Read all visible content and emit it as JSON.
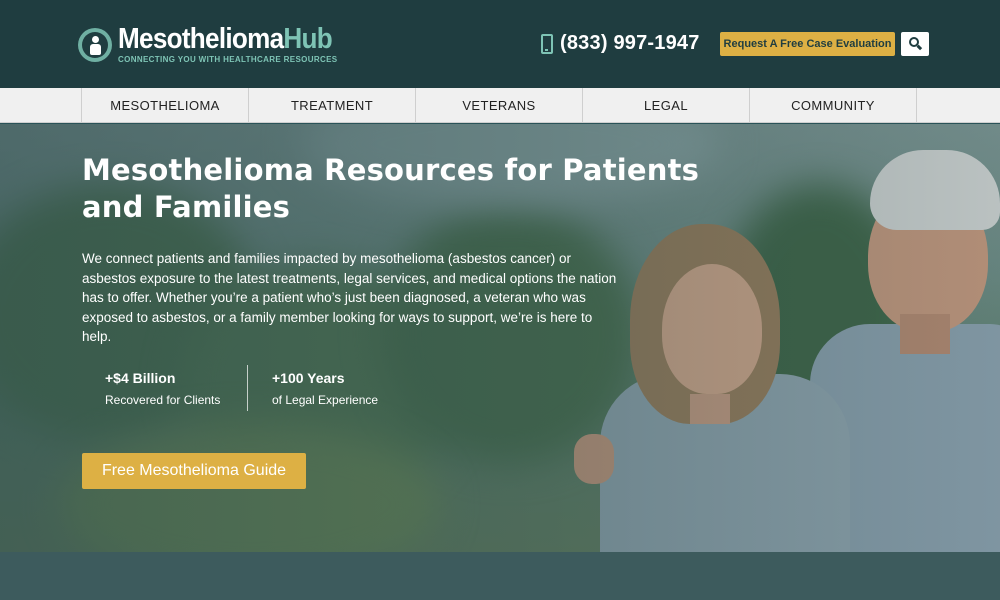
{
  "header": {
    "logo": {
      "name_part1": "Mesothelioma",
      "name_part2": "Hub",
      "tagline": "CONNECTING YOU WITH HEALTHCARE RESOURCES"
    },
    "phone": "(833) 997-1947",
    "cta_label": "Request A Free Case Evaluation",
    "search_icon": "search-icon"
  },
  "nav": {
    "items": [
      {
        "label": "MESOTHELIOMA"
      },
      {
        "label": "TREATMENT"
      },
      {
        "label": "VETERANS"
      },
      {
        "label": "LEGAL"
      },
      {
        "label": "COMMUNITY"
      }
    ]
  },
  "hero": {
    "title": "Mesothelioma Resources for Patients and Families",
    "description": "We connect patients and families impacted by mesothelioma (asbestos cancer) or asbestos exposure to the latest treatments, legal services, and medical options the nation has to offer. Whether you’re a patient who’s just been diagnosed, a veteran who was exposed to asbestos, or a family member looking for ways to support, we’re is here to help.",
    "stats": [
      {
        "value": "+$4 Billion",
        "label": "Recovered for Clients"
      },
      {
        "value": "+100 Years",
        "label": "of Legal Experience"
      }
    ],
    "button_label": "Free Mesothelioma Guide"
  },
  "colors": {
    "header_bg": "#1f3d40",
    "accent_teal": "#7ec4b5",
    "accent_gold": "#ddb044",
    "nav_bg": "#f0f0f0",
    "band_bg": "#3d5b5d"
  }
}
